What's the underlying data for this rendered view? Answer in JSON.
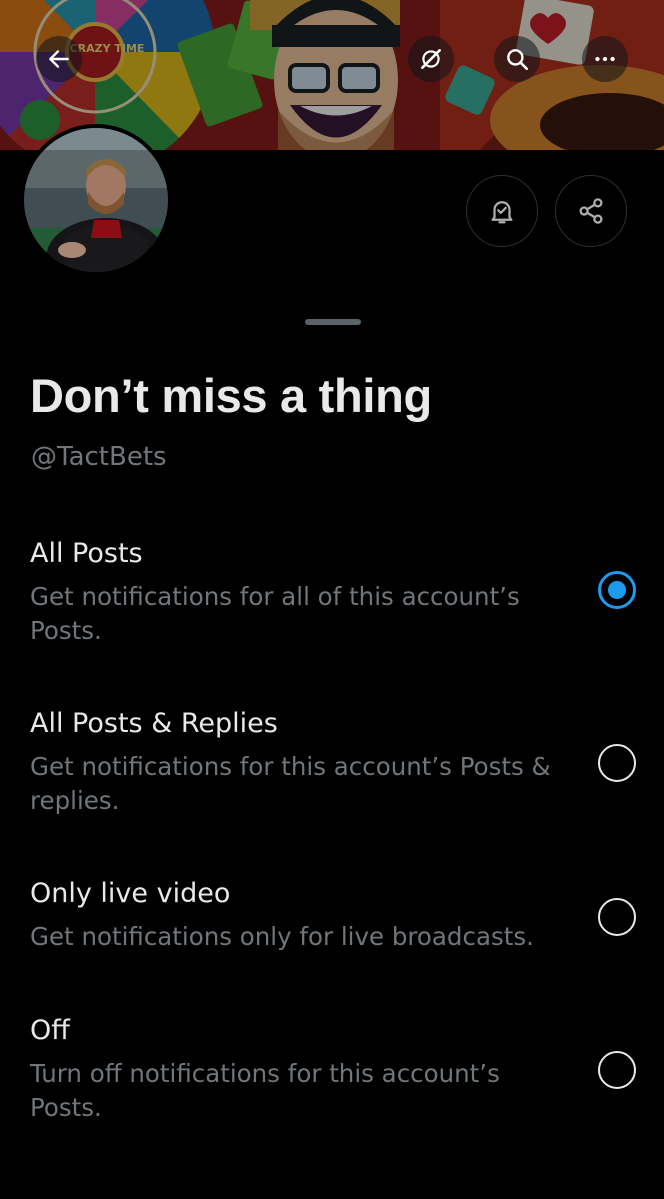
{
  "header": {
    "back_icon": "arrow-left-icon",
    "grok_icon": "grok-icon",
    "search_icon": "search-icon",
    "more_icon": "more-horizontal-icon",
    "banner_wheel_text": "CRAZY TIME"
  },
  "profile_actions": {
    "bell_icon": "bell-check-icon",
    "share_icon": "share-icon"
  },
  "sheet": {
    "title": "Don’t miss a thing",
    "handle": "@TactBets",
    "options": [
      {
        "title": "All Posts",
        "description": "Get notifications for all of this account’s Posts.",
        "selected": true
      },
      {
        "title": "All Posts & Replies",
        "description": "Get notifications for this account’s Posts & replies.",
        "selected": false
      },
      {
        "title": "Only live video",
        "description": "Get notifications only for live broadcasts.",
        "selected": false
      },
      {
        "title": "Off",
        "description": "Turn off notifications for this account’s Posts.",
        "selected": false
      }
    ]
  },
  "colors": {
    "background": "#000000",
    "accent": "#1d9bf0",
    "text_primary": "#e7e9ea",
    "text_secondary": "#71767b"
  }
}
